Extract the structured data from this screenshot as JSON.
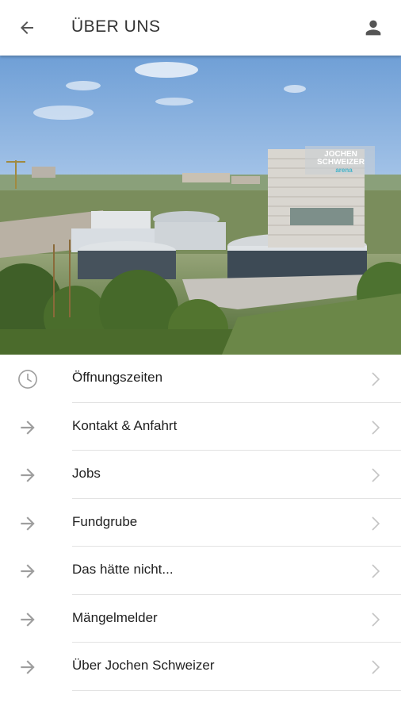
{
  "header": {
    "title": "ÜBER UNS",
    "back_icon": "arrow-left-icon",
    "profile_icon": "person-icon"
  },
  "hero": {
    "sign_line1": "JOCHEN",
    "sign_line2": "SCHWEIZER",
    "sign_line3": "arena"
  },
  "menu": {
    "items": [
      {
        "label": "Öffnungszeiten",
        "icon": "clock-icon"
      },
      {
        "label": "Kontakt & Anfahrt",
        "icon": "arrow-right-icon"
      },
      {
        "label": "Jobs",
        "icon": "arrow-right-icon"
      },
      {
        "label": "Fundgrube",
        "icon": "arrow-right-icon"
      },
      {
        "label": "Das hätte nicht...",
        "icon": "arrow-right-icon"
      },
      {
        "label": "Mängelmelder",
        "icon": "arrow-right-icon"
      },
      {
        "label": "Über Jochen Schweizer",
        "icon": "arrow-right-icon"
      }
    ]
  },
  "colors": {
    "icon_gray": "#9e9e9e",
    "chevron_gray": "#c4c4c4",
    "header_icon": "#555555"
  }
}
